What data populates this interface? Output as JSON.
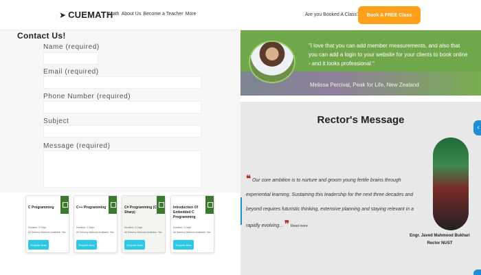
{
  "header": {
    "logo_text": "CUEMATH",
    "nav": [
      "Math",
      "About Us",
      "Become a Teacher",
      "More"
    ],
    "cta_text": "Are you Booked A Class?",
    "cta_button": "Book A FREE Class"
  },
  "contact_form": {
    "title": "Contact Us!",
    "fields": [
      {
        "label": "Name (required)",
        "value": ""
      },
      {
        "label": "Email (required)",
        "value": ""
      },
      {
        "label": "Phone Number (required)",
        "value": ""
      },
      {
        "label": "Subject",
        "value": ""
      },
      {
        "label": "Message (required)",
        "value": ""
      }
    ]
  },
  "testimonial": {
    "quote": "\"I love that you can add member measurements, and also that you can add a login to your website for your clients to book online - and it looks professional.\"",
    "author": "Melissa Percival, Peak for Life, New Zealand"
  },
  "rector": {
    "title": "Rector's Message",
    "message": "Our core ambition is to nurture and groom young fertile brains through experiential learning. Sustaining this leadership for the next three decades and beyond requires futuristic thinking, extensive planning and staying relevant in a rapidly evolving...",
    "open_quote": "❝",
    "close_quote": "❞",
    "read_more": "Read more",
    "name_line1": "Engr. Javed Mahmood Bukhari",
    "name_line2": "Rector NUST"
  },
  "courses": [
    {
      "title": "C Programming",
      "duration": "Duration: 2 Days",
      "delivery": "All Delivery Methods Available: Yes",
      "button": "Enquire Now"
    },
    {
      "title": "C++ Programming",
      "duration": "Duration: 2 Days",
      "delivery": "All Delivery Methods Available: Yes",
      "button": "Enquire Now"
    },
    {
      "title": "C# Programming (C Sharp)",
      "duration": "Duration: 2 Days",
      "delivery": "All Delivery Methods Available: Yes",
      "button": "Enquire Now"
    },
    {
      "title": "Introduction Of Embedded C Programming",
      "duration": "Duration: 2 Days",
      "delivery": "All Delivery Methods Available: Yes",
      "button": "Enquire Now"
    }
  ],
  "colors": {
    "cta": "#ff9f1a",
    "testimonial_bg": "#6fa84a",
    "course_button": "#2ec8e6",
    "side_arrow": "#1e8ed6"
  },
  "icons": [
    "rocket-icon",
    "chevron-left-icon",
    "bookmark-icon"
  ]
}
